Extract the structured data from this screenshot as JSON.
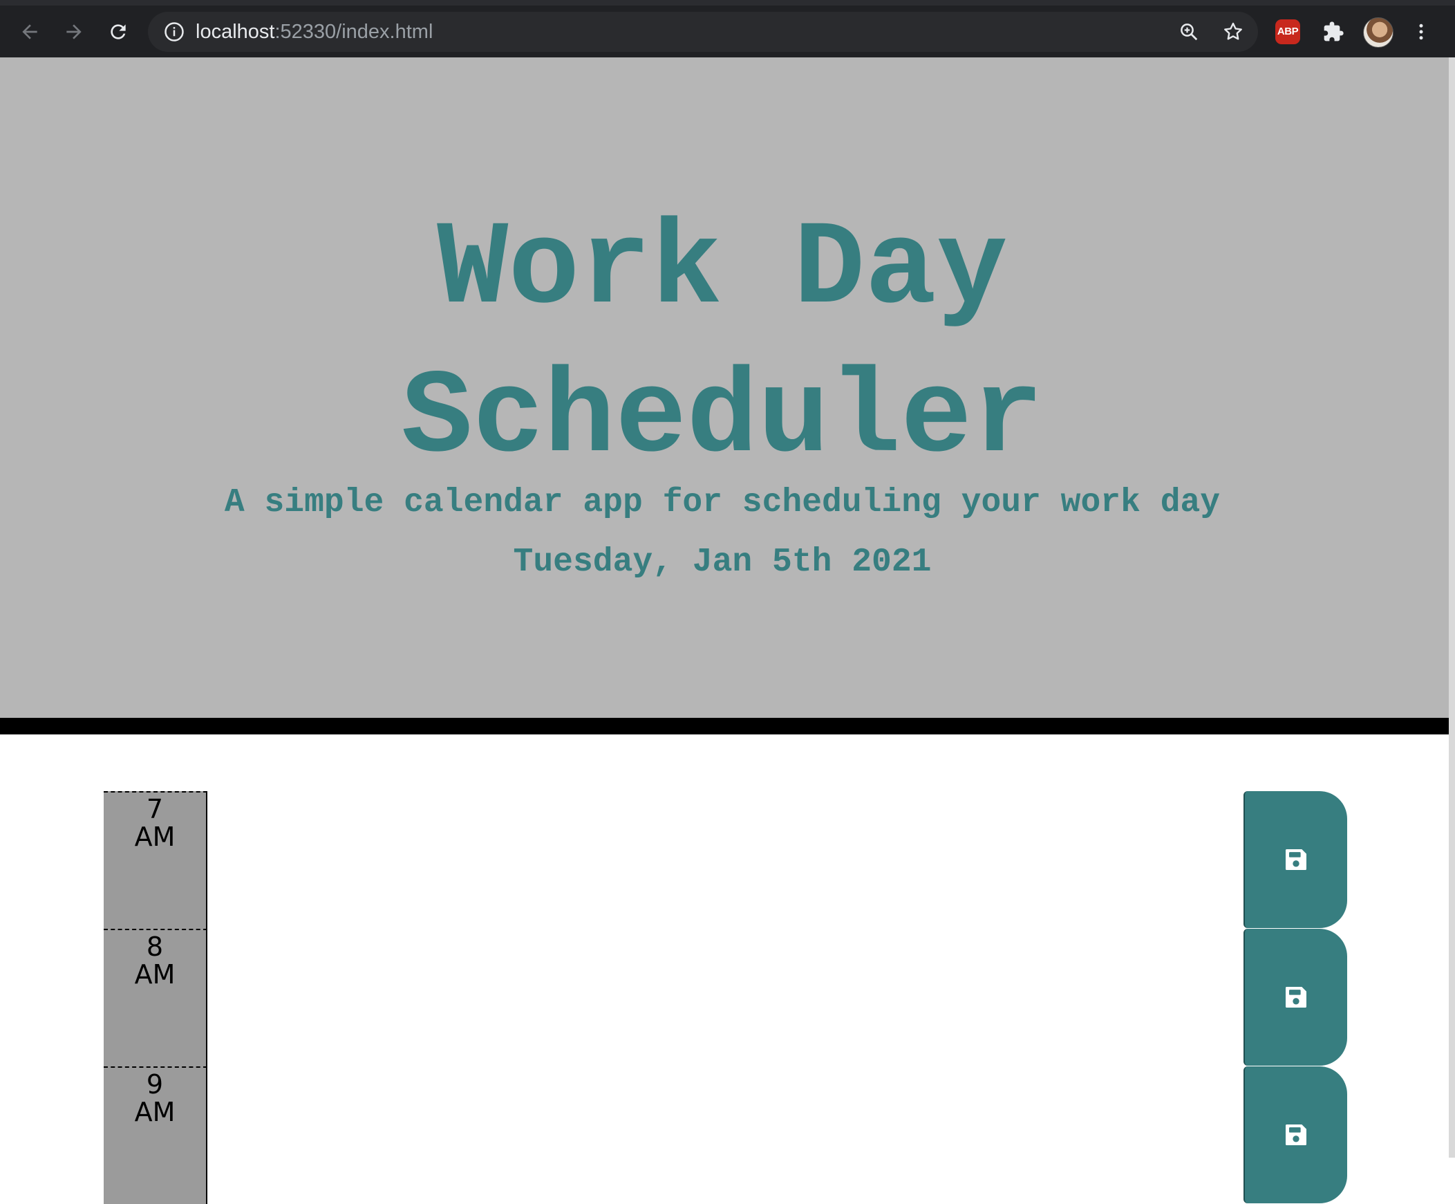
{
  "browser": {
    "url_host": "localhost",
    "url_path": ":52330/index.html",
    "extension_abp_label": "ABP",
    "icons": [
      "back-icon",
      "forward-icon",
      "reload-icon",
      "info-icon",
      "zoom-icon",
      "bookmark-star-icon",
      "puzzle-icon",
      "menu-kebab-icon"
    ]
  },
  "header": {
    "title_line1": "Work Day",
    "title_line2": "Scheduler",
    "lead": "A simple calendar app for scheduling your work day",
    "current_day": "Tuesday, Jan 5th 2021"
  },
  "colors": {
    "accent": "#377e80",
    "jumbotron_bg": "#b6b6b6",
    "hour_bg": "#9b9b9b",
    "browser_bg": "#202124"
  },
  "timeblocks": [
    {
      "hour": "7",
      "period": "AM",
      "description": ""
    },
    {
      "hour": "8",
      "period": "AM",
      "description": ""
    },
    {
      "hour": "9",
      "period": "AM",
      "description": ""
    }
  ],
  "save_icon": "save-floppy-icon"
}
